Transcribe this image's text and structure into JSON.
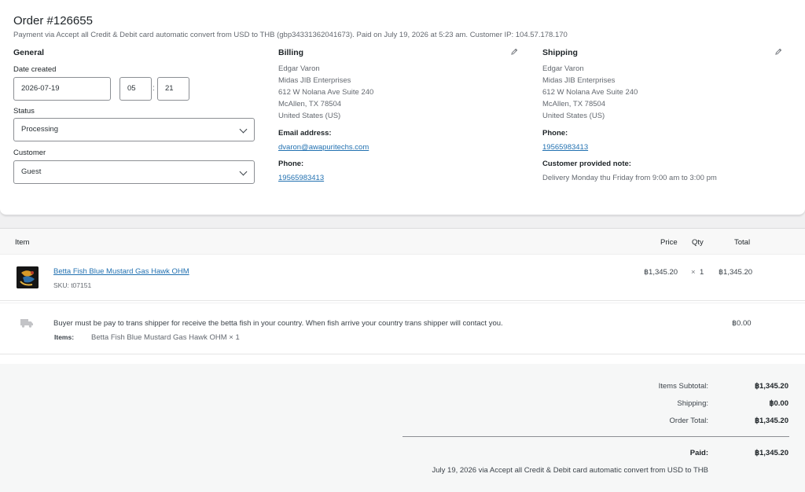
{
  "order": {
    "title": "Order #126655",
    "meta": "Payment via Accept all Credit & Debit card automatic convert from USD to THB (gbp34331362041673). Paid on July 19, 2026 at 5:23 am. Customer IP: 104.57.178.170"
  },
  "general": {
    "heading": "General",
    "date_label": "Date created",
    "date_value": "2026-07-19",
    "hour_value": "05",
    "time_sep": ":",
    "minute_value": "21",
    "status_label": "Status",
    "status_value": "Processing",
    "customer_label": "Customer",
    "customer_value": "Guest"
  },
  "billing": {
    "heading": "Billing",
    "address": [
      "Edgar Varon",
      "Midas JIB Enterprises",
      "612 W Nolana Ave Suite 240",
      "McAllen, TX 78504",
      "United States (US)"
    ],
    "email_label": "Email address:",
    "email": "dvaron@awapuritechs.com",
    "phone_label": "Phone:",
    "phone": "19565983413"
  },
  "shipping": {
    "heading": "Shipping",
    "address": [
      "Edgar Varon",
      "Midas JIB Enterprises",
      "612 W Nolana Ave Suite 240",
      "McAllen, TX 78504",
      "United States (US)"
    ],
    "phone_label": "Phone:",
    "phone": "19565983413",
    "note_label": "Customer provided note:",
    "note": "Delivery Monday thu Friday from 9:00 am to 3:00 pm"
  },
  "items_table": {
    "columns": {
      "item": "Item",
      "price": "Price",
      "qty": "Qty",
      "total": "Total"
    },
    "line_item": {
      "name": "Betta Fish Blue Mustard Gas Hawk OHM",
      "sku": "SKU: t07151",
      "price": "฿1,345.20",
      "qty_prefix": "×",
      "qty": "1",
      "total": "฿1,345.20"
    },
    "shipping_line": {
      "description": "Buyer must be pay to trans shipper for receive the betta fish in your country. When fish arrive your country trans shipper will contact you.",
      "items_label": "Items:",
      "items_value": "Betta Fish Blue Mustard Gas Hawk OHM × 1",
      "amount": "฿0.00"
    }
  },
  "totals": {
    "subtotal_label": "Items Subtotal:",
    "subtotal": "฿1,345.20",
    "shipping_label": "Shipping:",
    "shipping": "฿0.00",
    "order_total_label": "Order Total:",
    "order_total": "฿1,345.20",
    "paid_label": "Paid:",
    "paid": "฿1,345.20",
    "paid_note": "July 19, 2026 via Accept all Credit & Debit card automatic convert from USD to THB"
  },
  "icons": {
    "edit": "pencil-icon",
    "shipping": "truck-icon",
    "thumb": "product-thumbnail"
  },
  "colors": {
    "link": "#2271b1",
    "text": "#3c434a",
    "heading": "#1d2327",
    "muted": "#646970"
  }
}
